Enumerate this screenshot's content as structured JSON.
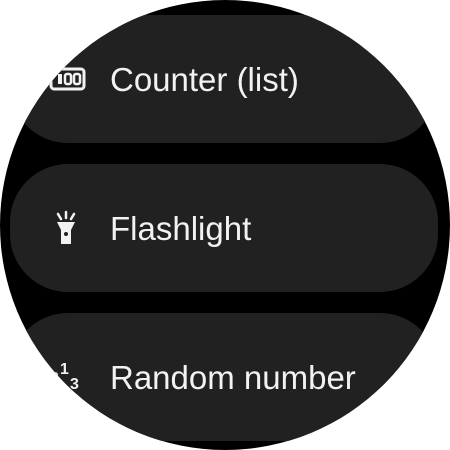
{
  "menu": {
    "items": [
      {
        "label": "Counter (list)",
        "icon": "counter-icon"
      },
      {
        "label": "Flashlight",
        "icon": "flashlight-icon"
      },
      {
        "label": "Random number",
        "icon": "random-number-icon"
      }
    ]
  },
  "colors": {
    "background": "#000000",
    "chip": "#212121",
    "text": "#f2f2f2"
  }
}
